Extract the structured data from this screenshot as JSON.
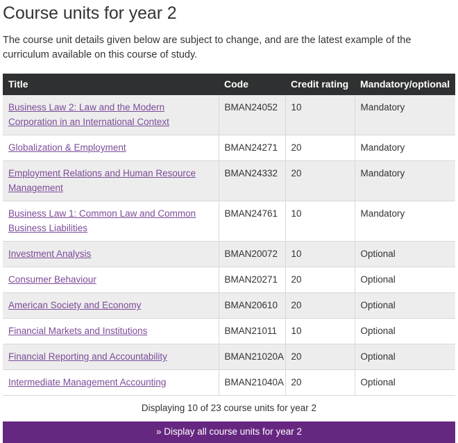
{
  "page": {
    "title": "Course units for year 2",
    "intro": "The course unit details given below are subject to change, and are the latest example of the curriculum available on this course of study."
  },
  "colors": {
    "header_background": "#2f3031",
    "header_text": "#ffffff",
    "link": "#7c4b99",
    "accent_purple": "#662780",
    "row_stripe": "#ededed",
    "row_plain": "#ffffff",
    "border": "#d8d8d8",
    "body_text": "#333333"
  },
  "table": {
    "columns": [
      {
        "label": "Title"
      },
      {
        "label": "Code"
      },
      {
        "label": "Credit rating"
      },
      {
        "label": "Mandatory/optional"
      }
    ],
    "rows": [
      {
        "title": "Business Law 2: Law and the Modern Corporation in an International Context",
        "code": "BMAN24052",
        "credit": "10",
        "mandatory": "Mandatory"
      },
      {
        "title": "Globalization & Employment",
        "code": "BMAN24271",
        "credit": "20",
        "mandatory": "Mandatory"
      },
      {
        "title": "Employment Relations and Human Resource Management",
        "code": "BMAN24332",
        "credit": "20",
        "mandatory": "Mandatory"
      },
      {
        "title": "Business Law 1: Common Law and Common Business Liabilities",
        "code": "BMAN24761",
        "credit": "10",
        "mandatory": "Mandatory"
      },
      {
        "title": "Investment Analysis",
        "code": "BMAN20072",
        "credit": "10",
        "mandatory": "Optional"
      },
      {
        "title": "Consumer Behaviour",
        "code": "BMAN20271",
        "credit": "20",
        "mandatory": "Optional"
      },
      {
        "title": "American Society and Economy",
        "code": "BMAN20610",
        "credit": "20",
        "mandatory": "Optional"
      },
      {
        "title": "Financial Markets and Institutions",
        "code": "BMAN21011",
        "credit": "10",
        "mandatory": "Optional"
      },
      {
        "title": "Financial Reporting and Accountability",
        "code": "BMAN21020A",
        "credit": "20",
        "mandatory": "Optional"
      },
      {
        "title": "Intermediate Management Accounting",
        "code": "BMAN21040A",
        "credit": "20",
        "mandatory": "Optional"
      }
    ],
    "summary": "Displaying 10 of 23 course units for year 2"
  },
  "display_all_button": {
    "label": "» Display all course units for year 2"
  }
}
